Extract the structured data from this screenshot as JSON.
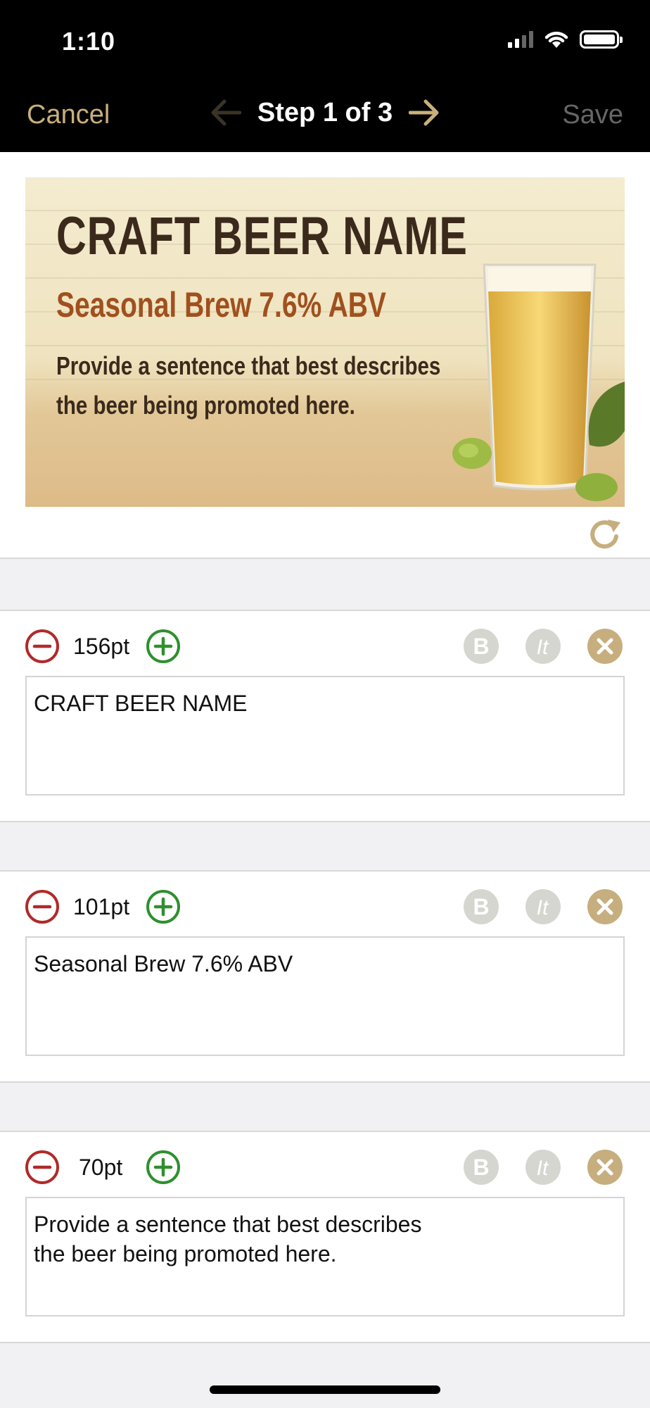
{
  "status_bar": {
    "time": "1:10"
  },
  "nav": {
    "cancel_label": "Cancel",
    "title": "Step 1 of 3",
    "save_label": "Save"
  },
  "banner": {
    "title": "CRAFT BEER NAME",
    "subtitle": "Seasonal Brew 7.6% ABV",
    "description": "Provide a sentence that best describes the beer being promoted here."
  },
  "text_fields": [
    {
      "size_label": "156pt",
      "value": "CRAFT BEER NAME"
    },
    {
      "size_label": "101pt",
      "value": "Seasonal Brew 7.6% ABV"
    },
    {
      "size_label": "70pt",
      "value": "Provide a sentence that best describes\nthe beer being promoted here."
    }
  ],
  "icons": {
    "decrease": "minus-circle-icon",
    "increase": "plus-circle-icon",
    "bold": "bold-icon",
    "italic": "italic-icon",
    "delete": "close-circle-icon",
    "refresh": "refresh-icon"
  },
  "colors": {
    "accent_gold": "#c9b07a",
    "decrease_red": "#b02a2a",
    "increase_green": "#2f8f2f",
    "disabled_gray": "#d6d6d0",
    "delete_tan": "#c6ae7e"
  }
}
